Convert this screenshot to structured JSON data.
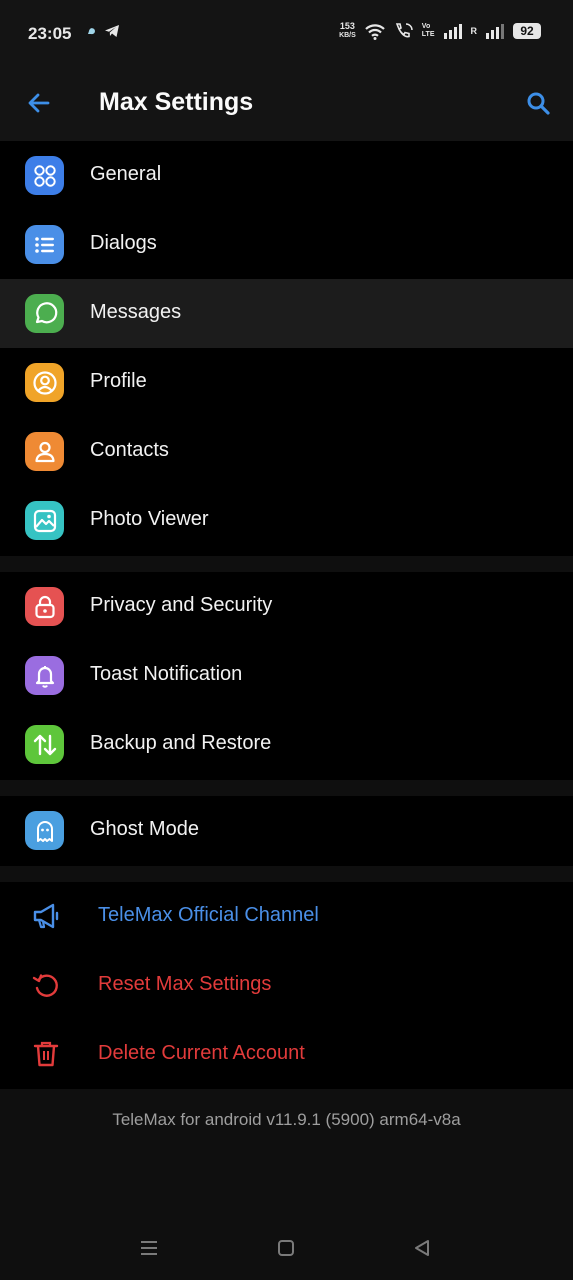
{
  "status_bar": {
    "time": "23:05",
    "net_speed_value": "153",
    "net_speed_unit": "KB/S",
    "volte_top": "Vo",
    "volte_bottom": "LTE",
    "roaming": "R",
    "battery": "92"
  },
  "app_bar": {
    "title": "Max Settings"
  },
  "sections": [
    {
      "items": [
        {
          "label": "General",
          "icon": "grid-icon",
          "color": "#3d7ee8"
        },
        {
          "label": "Dialogs",
          "icon": "list-icon",
          "color": "#4a8fe7"
        },
        {
          "label": "Messages",
          "icon": "chat-bubble-icon",
          "color": "#4cae4f"
        },
        {
          "label": "Profile",
          "icon": "user-circle-icon",
          "color": "#f0a428"
        },
        {
          "label": "Contacts",
          "icon": "person-icon",
          "color": "#ef8a34"
        },
        {
          "label": "Photo Viewer",
          "icon": "image-icon",
          "color": "#36c3c3"
        }
      ]
    },
    {
      "items": [
        {
          "label": "Privacy and Security",
          "icon": "lock-icon",
          "color": "#e55252"
        },
        {
          "label": "Toast Notification",
          "icon": "bell-icon",
          "color": "#9a6de0"
        },
        {
          "label": "Backup and Restore",
          "icon": "swap-arrows-icon",
          "color": "#5ec63b"
        }
      ]
    },
    {
      "items": [
        {
          "label": "Ghost Mode",
          "icon": "ghost-icon",
          "color": "#4a9fe0"
        }
      ]
    },
    {
      "items": [
        {
          "label": "TeleMax Official Channel",
          "icon": "megaphone-icon",
          "color": "#4a8fe7"
        },
        {
          "label": "Reset Max Settings",
          "icon": "reset-icon",
          "color": "#e23b3b"
        },
        {
          "label": "Delete Current Account",
          "icon": "trash-icon",
          "color": "#e23b3b"
        }
      ]
    }
  ],
  "version_text": "TeleMax for android v11.9.1 (5900) arm64-v8a",
  "nav_bar": {
    "icons": [
      "menu-icon",
      "home-icon",
      "back-triangle-icon"
    ]
  },
  "colors": {
    "accent": "#3d8fe8",
    "danger": "#e23b3b",
    "background": "#0f0f0f",
    "section_bg": "#000000"
  }
}
